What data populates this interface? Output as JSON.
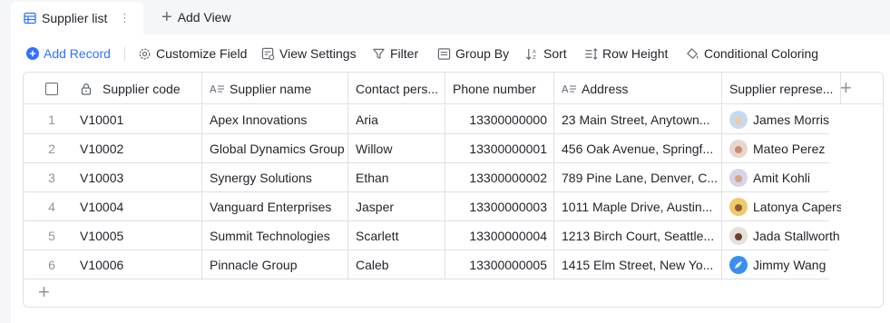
{
  "tabs": {
    "active_label": "Supplier list",
    "more_glyph": "⋮",
    "add_view_label": "Add View"
  },
  "toolbar": {
    "add_record": "Add Record",
    "customize_field": "Customize Field",
    "view_settings": "View Settings",
    "filter": "Filter",
    "group_by": "Group By",
    "sort": "Sort",
    "row_height": "Row Height",
    "conditional_coloring": "Conditional Coloring",
    "accent_color": "#3370ff"
  },
  "columns": [
    {
      "label": "Supplier code",
      "icon": "lock-icon"
    },
    {
      "label": "Supplier name",
      "icon": "text-field-icon"
    },
    {
      "label": "Contact pers...",
      "icon": ""
    },
    {
      "label": "Phone number",
      "icon": ""
    },
    {
      "label": "Address",
      "icon": "text-field-icon"
    },
    {
      "label": "Supplier represe...",
      "icon": ""
    }
  ],
  "rows": [
    {
      "num": "1",
      "code": "V10001",
      "name": "Apex Innovations",
      "contact": "Aria",
      "phone": "13300000000",
      "address": "23 Main Street, Anytown...",
      "rep": "James Morris",
      "avatar_color": "#c4d9f2"
    },
    {
      "num": "2",
      "code": "V10002",
      "name": "Global Dynamics Group",
      "contact": "Willow",
      "phone": "13300000001",
      "address": "456 Oak Avenue, Springf...",
      "rep": "Mateo Perez",
      "avatar_color": "#e7d6d0"
    },
    {
      "num": "3",
      "code": "V10003",
      "name": "Synergy Solutions",
      "contact": "Ethan",
      "phone": "13300000002",
      "address": "789 Pine Lane, Denver, C...",
      "rep": "Amit Kohli",
      "avatar_color": "#d8d2ea"
    },
    {
      "num": "4",
      "code": "V10004",
      "name": "Vanguard Enterprises",
      "contact": "Jasper",
      "phone": "13300000003",
      "address": "1011 Maple Drive, Austin...",
      "rep": "Latonya Capers",
      "avatar_color": "#f0c86a"
    },
    {
      "num": "5",
      "code": "V10005",
      "name": "Summit Technologies",
      "contact": "Scarlett",
      "phone": "13300000004",
      "address": "1213 Birch Court, Seattle...",
      "rep": "Jada Stallworth",
      "avatar_color": "#e5e0dc"
    },
    {
      "num": "6",
      "code": "V10006",
      "name": "Pinnacle Group",
      "contact": "Caleb",
      "phone": "13300000005",
      "address": "1415 Elm Street, New Yo...",
      "rep": "Jimmy Wang",
      "avatar_color": "#3a8ef0"
    }
  ]
}
